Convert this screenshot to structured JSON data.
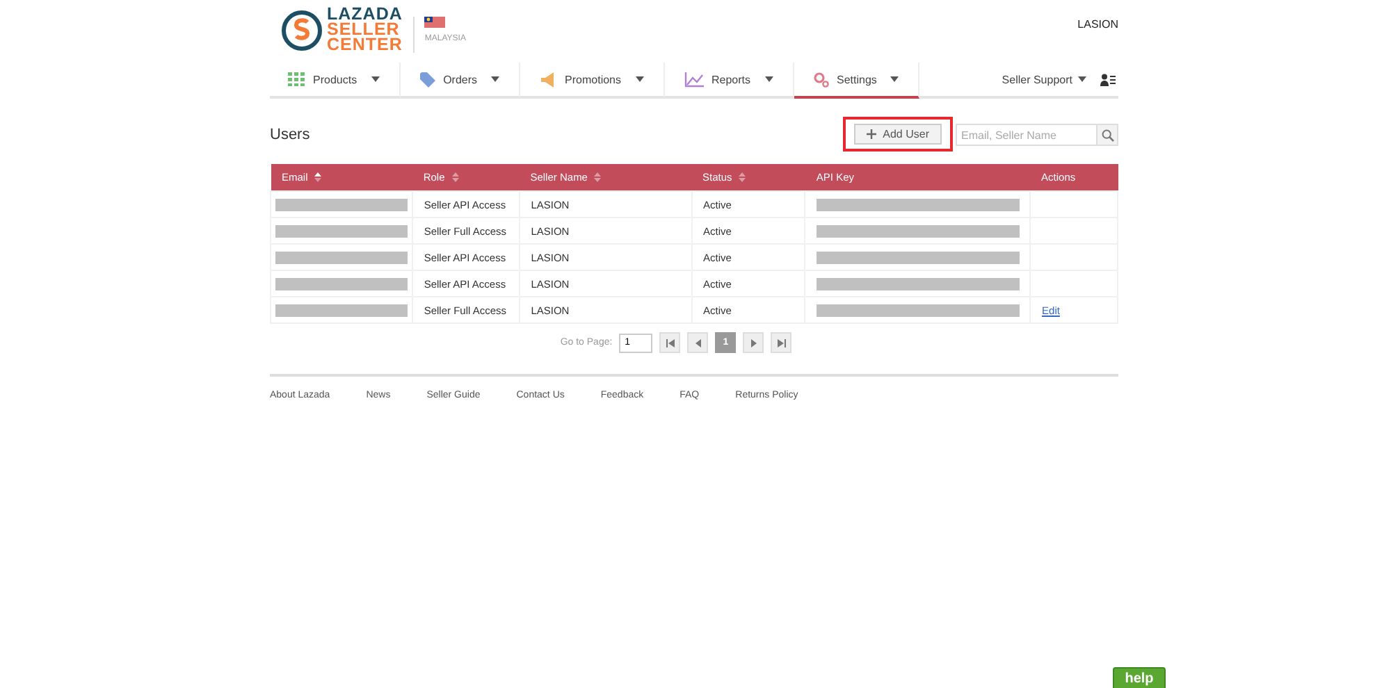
{
  "header": {
    "logo_lines": [
      "LAZADA",
      "SELLER",
      "CENTER"
    ],
    "country": "MALAYSIA",
    "account": "LASION"
  },
  "nav": [
    {
      "label": "Products",
      "selected": false
    },
    {
      "label": "Orders",
      "selected": false
    },
    {
      "label": "Promotions",
      "selected": false
    },
    {
      "label": "Reports",
      "selected": false
    },
    {
      "label": "Settings",
      "selected": true
    }
  ],
  "nav_right": {
    "label": "Seller Support"
  },
  "page_title": "Users",
  "add_user": {
    "label": "Add User",
    "highlighted": true
  },
  "search": {
    "placeholder": "Email, Seller Name"
  },
  "table": {
    "columns": [
      {
        "label": "Email",
        "kind": "sorted"
      },
      {
        "label": "Role",
        "kind": "sortable"
      },
      {
        "label": "Seller Name",
        "kind": "sortable"
      },
      {
        "label": "Status",
        "kind": "sortable"
      },
      {
        "label": "API Key",
        "kind": "plain"
      },
      {
        "label": "Actions",
        "kind": "plain"
      }
    ],
    "rows": [
      {
        "role": "Seller API Access",
        "seller_name": "LASION",
        "status": "Active"
      },
      {
        "role": "Seller Full Access",
        "seller_name": "LASION",
        "status": "Active"
      },
      {
        "role": "Seller API Access",
        "seller_name": "LASION",
        "status": "Active"
      },
      {
        "role": "Seller API Access",
        "seller_name": "LASION",
        "status": "Active"
      },
      {
        "role": "Seller Full Access",
        "seller_name": "LASION",
        "status": "Active",
        "action": "Edit"
      }
    ]
  },
  "pagination": {
    "label": "Go to Page:",
    "value": "1",
    "current": "1"
  },
  "footer": [
    "About Lazada",
    "News",
    "Seller Guide",
    "Contact Us",
    "Feedback",
    "FAQ",
    "Returns Policy"
  ],
  "help_button": "help"
}
